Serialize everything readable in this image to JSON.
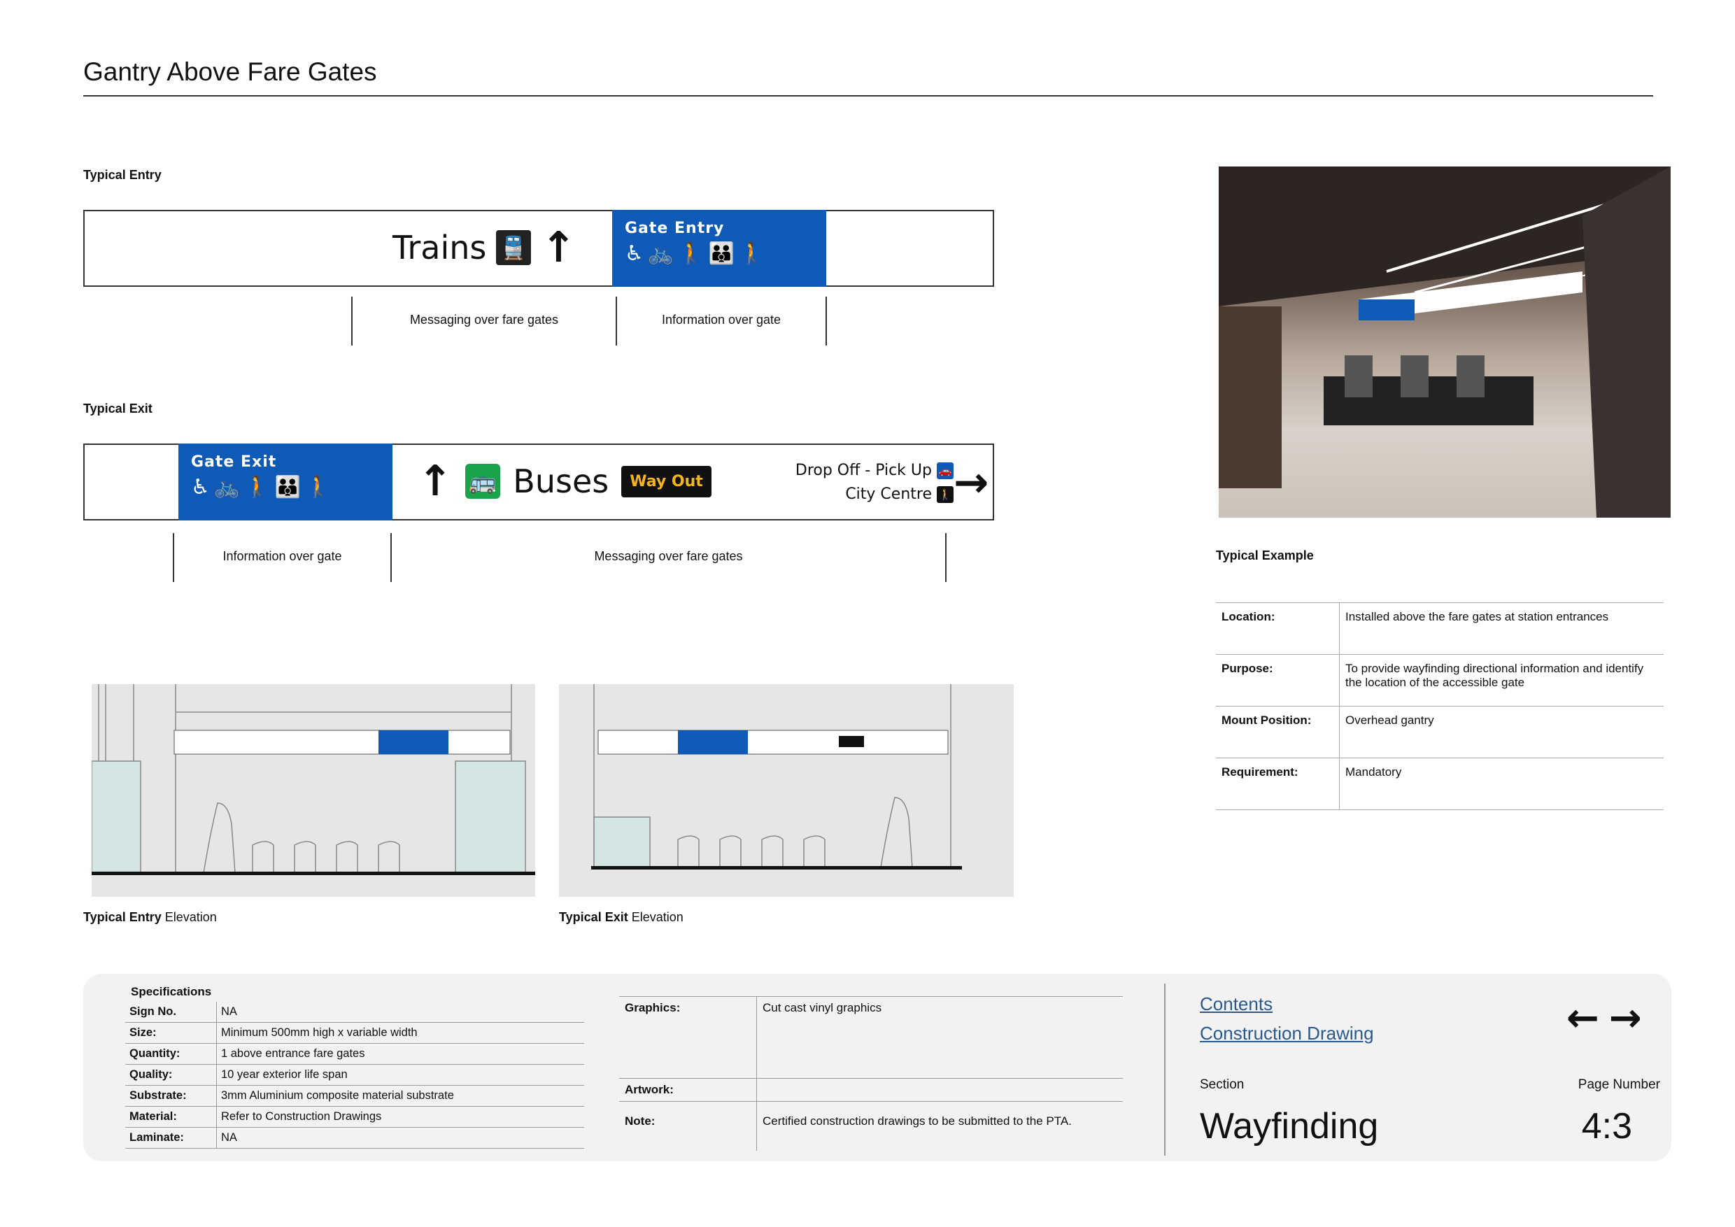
{
  "page": {
    "title": "Gantry Above Fare Gates"
  },
  "entry": {
    "heading": "Typical Entry",
    "trains_label": "Trains",
    "gate_label": "Gate Entry",
    "seg1": "Messaging over fare gates",
    "seg2": "Information over gate"
  },
  "exit": {
    "heading": "Typical Exit",
    "gate_label": "Gate Exit",
    "buses_label": "Buses",
    "way_out": "Way Out",
    "dest1": "Drop Off - Pick Up",
    "dest2": "City Centre",
    "seg1": "Information over gate",
    "seg2": "Messaging over fare gates"
  },
  "example": {
    "caption": "Typical Example",
    "rows": [
      {
        "key": "Location:",
        "value": "Installed above the fare gates at station entrances"
      },
      {
        "key": "Purpose:",
        "value": "To provide wayfinding directional information and identify the location of the accessible gate"
      },
      {
        "key": "Mount Position:",
        "value": "Overhead gantry"
      },
      {
        "key": "Requirement:",
        "value": "Mandatory"
      }
    ]
  },
  "elevations": {
    "entry_bold": "Typical Entry",
    "entry_rest": "Elevation",
    "exit_bold": "Typical Exit",
    "exit_rest": "Elevation"
  },
  "specs": {
    "heading": "Specifications",
    "rows": [
      {
        "key": "Sign No.",
        "value": "NA"
      },
      {
        "key": "Size:",
        "value": "Minimum 500mm high x variable width"
      },
      {
        "key": "Quantity:",
        "value": "1 above entrance fare gates"
      },
      {
        "key": "Quality:",
        "value": "10 year exterior life span"
      },
      {
        "key": "Substrate:",
        "value": "3mm Aluminium composite material substrate"
      },
      {
        "key": "Material:",
        "value": "Refer to Construction Drawings"
      },
      {
        "key": "Laminate:",
        "value": "NA"
      }
    ],
    "graphics_key": "Graphics:",
    "graphics_value": "Cut cast vinyl graphics",
    "artwork_key": "Artwork:",
    "artwork_value": "",
    "note_key": "Note:",
    "note_value": "Certified construction drawings to be submitted to the PTA."
  },
  "nav": {
    "link1": "Contents",
    "link2": "Construction Drawing",
    "section_label": "Section",
    "section_value": "Wayfinding",
    "page_label": "Page Number",
    "page_value": "4:3"
  },
  "colors": {
    "sign_blue": "#0f5ab6",
    "bus_green": "#1aa34a",
    "way_out_yellow": "#f4b41a"
  }
}
